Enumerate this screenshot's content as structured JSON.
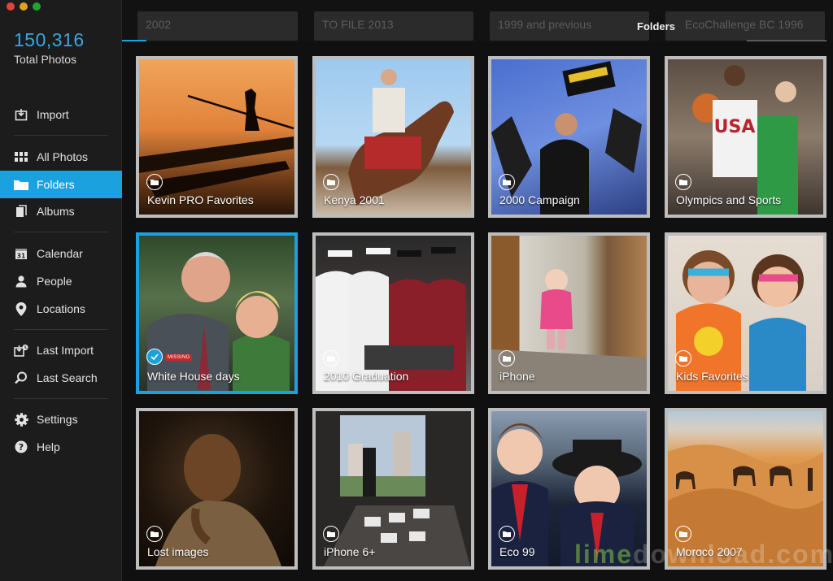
{
  "sidebar": {
    "total_count": "150,316",
    "total_label": "Total Photos",
    "items": [
      {
        "id": "import",
        "label": "Import",
        "icon": "import-icon"
      },
      {
        "id": "all-photos",
        "label": "All Photos",
        "icon": "grid-icon"
      },
      {
        "id": "folders",
        "label": "Folders",
        "icon": "folder-icon",
        "active": true
      },
      {
        "id": "albums",
        "label": "Albums",
        "icon": "album-icon"
      },
      {
        "id": "calendar",
        "label": "Calendar",
        "icon": "calendar-icon",
        "icon_text": "31"
      },
      {
        "id": "people",
        "label": "People",
        "icon": "person-icon"
      },
      {
        "id": "locations",
        "label": "Locations",
        "icon": "location-pin-icon"
      },
      {
        "id": "last-import",
        "label": "Last Import",
        "icon": "last-import-icon"
      },
      {
        "id": "last-search",
        "label": "Last Search",
        "icon": "search-icon"
      },
      {
        "id": "settings",
        "label": "Settings",
        "icon": "gear-icon"
      },
      {
        "id": "help",
        "label": "Help",
        "icon": "help-icon"
      }
    ]
  },
  "topbar": {
    "title": "Folders",
    "crumbs": [
      "2002",
      "TO FILE 2013",
      "1999 and previous",
      "EcoChallenge BC 1996"
    ]
  },
  "folders": [
    {
      "label": "Kevin PRO Favorites"
    },
    {
      "label": "Kenya 2001"
    },
    {
      "label": "2000 Campaign"
    },
    {
      "label": "Olympics and Sports"
    },
    {
      "label": "White House days",
      "selected": true,
      "badge": "MISSING"
    },
    {
      "label": "2010 Graduation"
    },
    {
      "label": "iPhone"
    },
    {
      "label": "Kids Favorites"
    },
    {
      "label": "Lost images"
    },
    {
      "label": "iPhone 6+"
    },
    {
      "label": "Eco 99"
    },
    {
      "label": "Moroco 2007"
    }
  ],
  "watermark": {
    "part1": "lime",
    "part2": "download.com"
  },
  "colors": {
    "accent": "#1ba1de",
    "sidebar_bg": "#1c1c1c",
    "tile_border": "#bdbdbd",
    "missing": "#c62828"
  }
}
